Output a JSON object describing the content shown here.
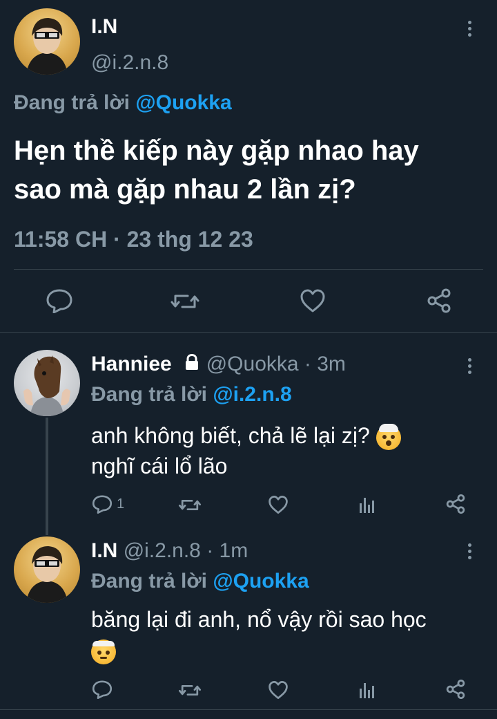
{
  "main_tweet": {
    "author_name": "I.N",
    "handle": "@i.2.n.8",
    "replying_prefix": "Đang trả lời",
    "replying_to": "@Quokka",
    "text_line1": "Hẹn thề kiếp này gặp nhao hay",
    "text_line2": "sao mà gặp nhau 2 lần zị?",
    "timestamp": "11:58 CH · 23 thg 12 23",
    "actions": [
      "reply-icon",
      "retweet-icon",
      "like-icon",
      "share-icon"
    ]
  },
  "replies": [
    {
      "author_name": "Hanniee",
      "handle_time": "@Quokka · 3m",
      "replying_prefix": "Đang trả lời",
      "replying_to": "@i.2.n.8",
      "text_line1": "anh không biết, chả lẽ lại zị?",
      "text_line2": "nghĩ cái lổ lão",
      "reply_count": "1",
      "protected": true
    },
    {
      "author_name": "I.N",
      "handle_time": "@i.2.n.8 · 1m",
      "replying_prefix": "Đang trả lời",
      "replying_to": "@Quokka",
      "text_line1": "băng lại đi anh, nổ vậy rồi sao học",
      "reply_count": ""
    }
  ],
  "colors": {
    "background": "#15202b",
    "text": "#ffffff",
    "secondary": "#8899a6",
    "accent": "#1da1f2",
    "divider": "#38444d"
  }
}
